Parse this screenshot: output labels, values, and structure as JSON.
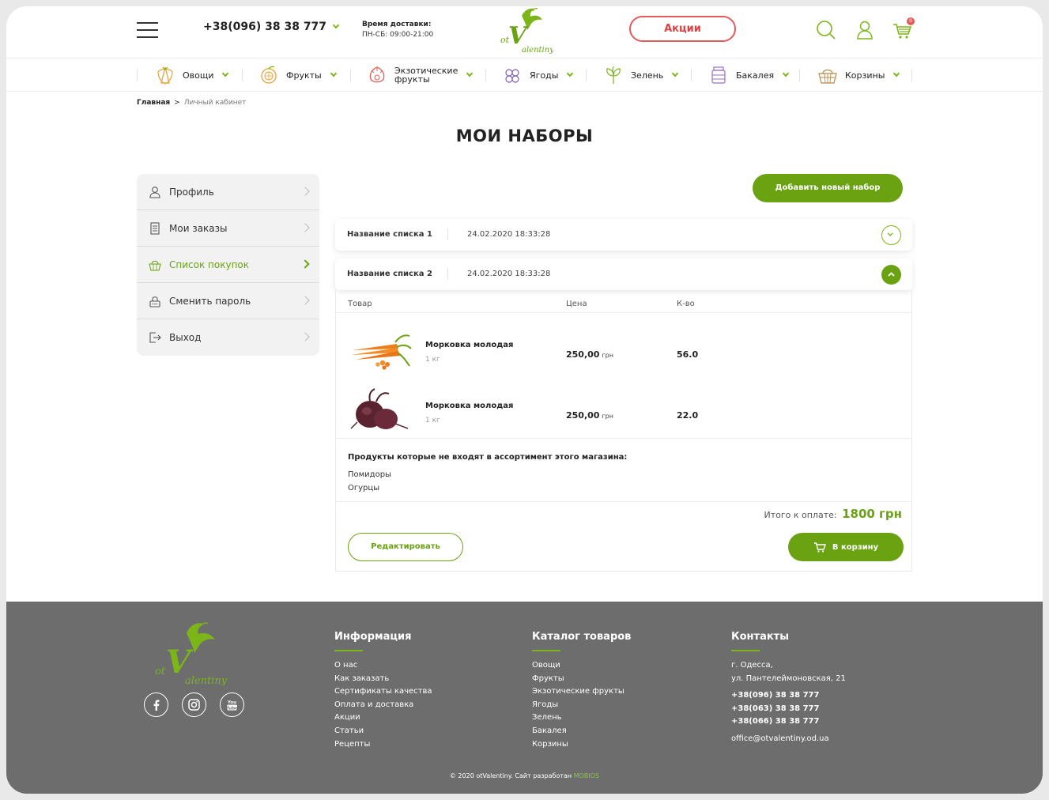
{
  "header": {
    "phone": "+38(096) 38 38 777",
    "delivery_title": "Время доставки:",
    "delivery_hours": "ПН-СБ: 09:00-21:00",
    "promo_label": "Акции",
    "cart_count": "0"
  },
  "categories": [
    {
      "label": "Овощи",
      "icon": "carrot-icon"
    },
    {
      "label": "Фрукты",
      "icon": "orange-icon"
    },
    {
      "label": "Экзотические",
      "label2": "фрукты",
      "icon": "dragonfruit-icon"
    },
    {
      "label": "Ягоды",
      "icon": "berries-icon"
    },
    {
      "label": "Зелень",
      "icon": "herbs-icon"
    },
    {
      "label": "Бакалея",
      "icon": "jar-icon"
    },
    {
      "label": "Корзины",
      "icon": "basket-icon"
    }
  ],
  "breadcrumb": {
    "home": "Главная",
    "separator": ">",
    "current": "Личный кабинет"
  },
  "page_title": "МОИ НАБОРЫ",
  "sidebar": {
    "items": [
      {
        "label": "Профиль",
        "icon": "user-icon"
      },
      {
        "label": "Мои заказы",
        "icon": "document-icon"
      },
      {
        "label": "Список покупок",
        "icon": "basket-list-icon"
      },
      {
        "label": "Сменить пароль",
        "icon": "lock-icon"
      },
      {
        "label": "Выход",
        "icon": "logout-icon"
      }
    ],
    "active_index": 2
  },
  "actions": {
    "add_new_set": "Добавить новый набор"
  },
  "lists": [
    {
      "name": "Название списка 1",
      "date": "24.02.2020 18:33:28",
      "expanded": false
    },
    {
      "name": "Название списка 2",
      "date": "24.02.2020 18:33:28",
      "expanded": true
    }
  ],
  "table": {
    "headers": {
      "product": "Товар",
      "price": "Цена",
      "qty": "К-во"
    },
    "rows": [
      {
        "name": "Морковка молодая",
        "weight": "1 кг",
        "price": "250,00",
        "currency": "грн",
        "qty": "56.0",
        "image": "carrots-image"
      },
      {
        "name": "Морковка молодая",
        "weight": "1 кг",
        "price": "250,00",
        "currency": "грн",
        "qty": "22.0",
        "image": "beets-image"
      }
    ]
  },
  "missing": {
    "title": "Продукты которые не входят в ассортимент этого магазина:",
    "items": [
      "Помидоры",
      "Огурцы"
    ]
  },
  "total": {
    "label": "Итого к оплате:",
    "value": "1800 грн"
  },
  "buttons": {
    "edit": "Редактировать",
    "to_cart": "В корзину"
  },
  "footer": {
    "info": {
      "title": "Информация",
      "links": [
        "О нас",
        "Как заказать",
        "Сертификаты качества",
        "Оплата и доставка",
        "Акции",
        "Статьи",
        "Рецепты"
      ]
    },
    "catalog": {
      "title": "Каталог товаров",
      "links": [
        "Овощи",
        "Фрукты",
        "Экзотические фрукты",
        "Ягоды",
        "Зелень",
        "Бакалея",
        "Корзины"
      ]
    },
    "contacts": {
      "title": "Контакты",
      "city": "г. Одесса,",
      "street": "ул. Пантелеймоновская, 21",
      "phones": [
        "+38(096) 38 38 777",
        "+38(063) 38 38 777",
        "+38(066) 38 38 777"
      ],
      "email": "office@otvalentiny.od.ua"
    },
    "copyright": "© 2020 otValentiny. Сайт разработан",
    "developer": "MOBIOS"
  },
  "logo": {
    "line1": "ot",
    "line2": "V",
    "line3": "alentiny"
  },
  "colors": {
    "accent": "#6aa212",
    "promo": "#e45a5a",
    "footer_bg": "#6d6d6d"
  }
}
